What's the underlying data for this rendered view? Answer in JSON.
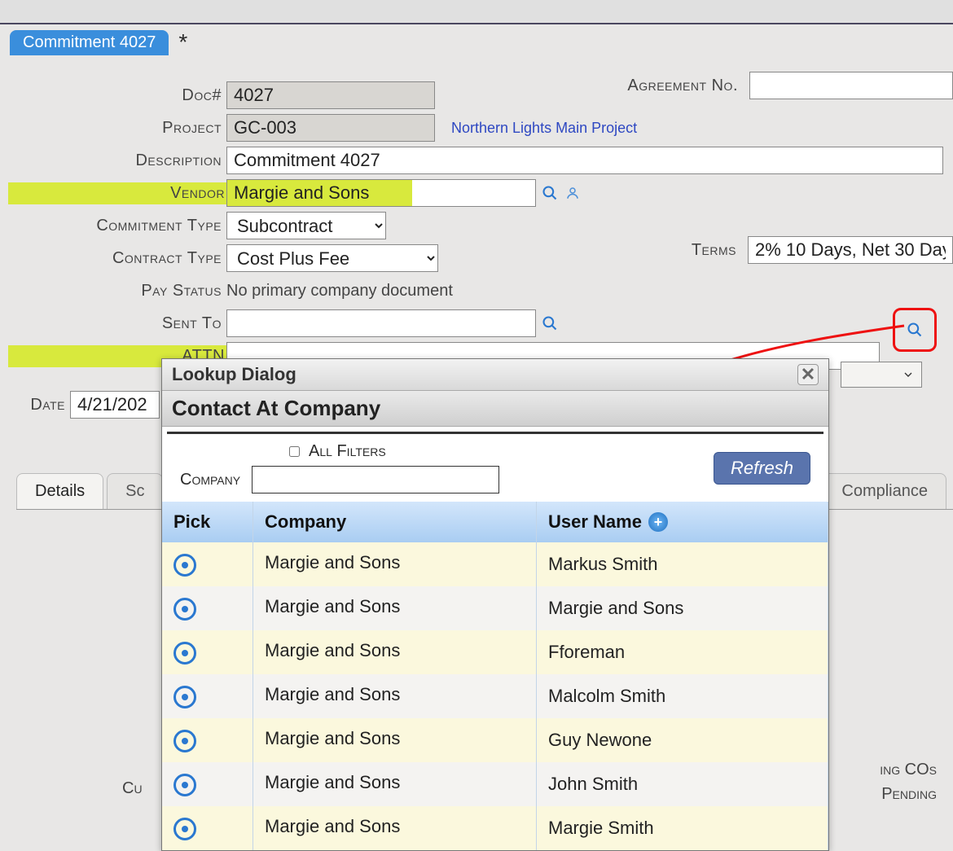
{
  "tab": {
    "title": "Commitment 4027",
    "dirty_marker": "*"
  },
  "form": {
    "doc_label": "Doc#",
    "doc_value": "4027",
    "agreement_label": "Agreement No.",
    "agreement_value": "",
    "project_label": "Project",
    "project_value": "GC-003",
    "project_name": "Northern Lights Main Project",
    "description_label": "Description",
    "description_value": "Commitment 4027",
    "vendor_label": "Vendor",
    "vendor_value": "Margie and Sons",
    "commitment_type_label": "Commitment Type",
    "commitment_type_value": "Subcontract",
    "contract_type_label": "Contract Type",
    "contract_type_value": "Cost Plus Fee",
    "terms_label": "Terms",
    "terms_value": "2% 10 Days, Net 30 Day",
    "pay_status_label": "Pay Status",
    "pay_status_value": "No primary company document",
    "sent_to_label": "Sent To",
    "sent_to_value": "",
    "attn_label": "ATTN",
    "attn_value": "",
    "date_label": "Date",
    "date_value": "4/21/202"
  },
  "tabs": {
    "details": "Details",
    "second": "Sc",
    "compliance": "Compliance"
  },
  "footer": {
    "cu": "Cu",
    "line1": "ing COs",
    "line2": "Pending"
  },
  "dialog": {
    "title": "Lookup Dialog",
    "subtitle": "Contact At Company",
    "all_filters_label": "All Filters",
    "company_label": "Company",
    "company_filter_value": "",
    "refresh": "Refresh",
    "columns": {
      "pick": "Pick",
      "company": "Company",
      "user": "User Name"
    },
    "rows": [
      {
        "company": "Margie and Sons",
        "user": "Markus Smith"
      },
      {
        "company": "Margie and Sons",
        "user": "Margie and Sons"
      },
      {
        "company": "Margie and Sons",
        "user": "Fforeman"
      },
      {
        "company": "Margie and Sons",
        "user": "Malcolm Smith"
      },
      {
        "company": "Margie and Sons",
        "user": "Guy Newone"
      },
      {
        "company": "Margie and Sons",
        "user": "John Smith"
      },
      {
        "company": "Margie and Sons",
        "user": "Margie Smith"
      }
    ]
  }
}
